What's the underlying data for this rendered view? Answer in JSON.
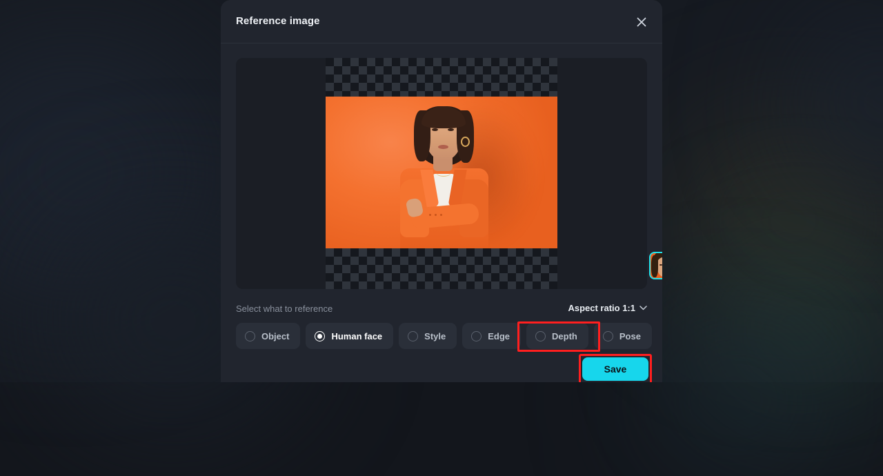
{
  "modal": {
    "title": "Reference image",
    "close_icon": "close-icon"
  },
  "canvas": {
    "transparency_pattern": "checkerboard",
    "face_detection": {
      "bracket_color": "#22e2ea",
      "thumbnail_border_color": "#22e2ea"
    },
    "photo_description": "Woman in orange blazer with arms crossed on orange background"
  },
  "controls": {
    "section_label": "Select what to reference",
    "aspect_ratio": {
      "label": "Aspect ratio 1:1",
      "chevron_icon": "chevron-down-icon"
    },
    "options": [
      {
        "label": "Object",
        "selected": false
      },
      {
        "label": "Human face",
        "selected": true
      },
      {
        "label": "Style",
        "selected": false
      },
      {
        "label": "Edge",
        "selected": false
      },
      {
        "label": "Depth",
        "selected": false
      },
      {
        "label": "Pose",
        "selected": false
      }
    ]
  },
  "footer": {
    "save_label": "Save"
  },
  "colors": {
    "accent": "#17d6ec",
    "highlight": "#ff1f1f",
    "modal_bg": "#21252e",
    "page_bg": "#161a21"
  }
}
